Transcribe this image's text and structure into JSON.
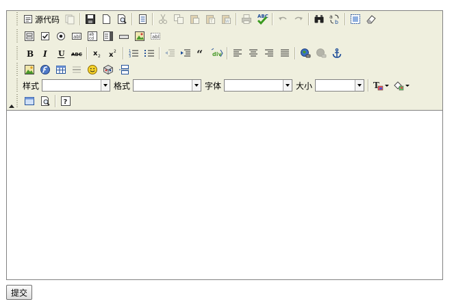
{
  "toolbar": {
    "source_label": "源代码",
    "style_label": "样式",
    "format_label": "格式",
    "font_label": "字体",
    "size_label": "大小",
    "style_value": "",
    "format_value": "",
    "font_value": "",
    "size_value": ""
  },
  "content": {
    "text": ""
  },
  "form": {
    "submit_label": "提交"
  },
  "colors": {
    "toolbar_bg": "#efefde",
    "border": "#808080",
    "icon_blue": "#1f4e99",
    "icon_green": "#4a9a2a"
  }
}
